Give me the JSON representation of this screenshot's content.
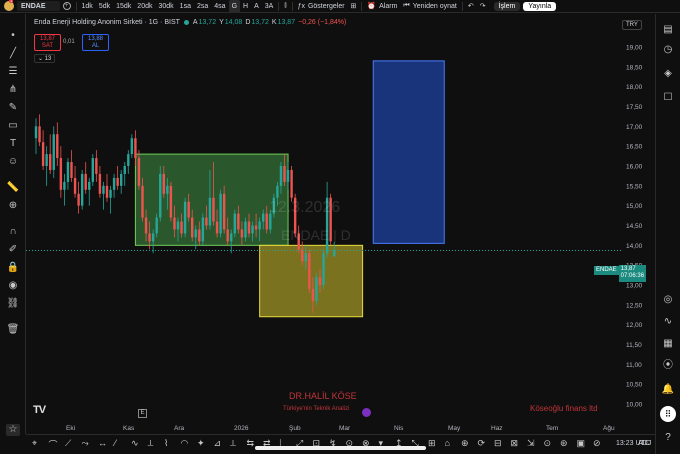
{
  "topbar": {
    "notification_count": "1",
    "symbol": "ENDAE",
    "intervals": [
      "1dk",
      "5dk",
      "15dk",
      "20dk",
      "30dk",
      "1sa",
      "2sa",
      "4sa",
      "G",
      "H",
      "A",
      "3A"
    ],
    "active_interval": "G",
    "indicators_label": "Göstergeler",
    "alarm_label": "Alarm",
    "replay_label": "Yeniden oynat",
    "trade_label": "İşlem",
    "publish_label": "Yayınla"
  },
  "legend": {
    "title": "Enda Enerji Holding Anonim Sirketi · 1G · BIST",
    "o_label": "A",
    "o_value": "13,72",
    "h_label": "Y",
    "h_value": "14,08",
    "l_label": "D",
    "l_value": "13,72",
    "c_label": "K",
    "c_value": "13,87",
    "change": "−0,26 (−1,84%)",
    "sell_price": "13,87",
    "sell_label": "SAT",
    "spread": "0,01",
    "buy_price": "13,88",
    "buy_label": "AL",
    "indicator_count": "13"
  },
  "currency": "TRY",
  "price_label": {
    "symbol": "ENDAE",
    "price": "13,87",
    "countdown": "07:06:36"
  },
  "watermark": {
    "date": "12.3.2026",
    "symbol_text": "ENDAE | D"
  },
  "branding": {
    "author": "DR.HALİL KÖSE",
    "subtitle": "Türkiye'nin Teknik Analizi",
    "firm": "Köseoğlu finans ltd"
  },
  "time_display": "13:23 UTC",
  "adj_label": "ADJ",
  "colors": {
    "up": "#26a69a",
    "down": "#ef5350",
    "green_zone": "#4caf50",
    "yellow_zone": "#d4c42c",
    "blue_zone": "#2962ff",
    "accent": "#2962ff"
  },
  "chart_data": {
    "type": "candlestick",
    "y_axis": [
      "19,00",
      "18,50",
      "18,00",
      "17,50",
      "17,00",
      "16,50",
      "16,00",
      "15,50",
      "15,00",
      "14,50",
      "14,00",
      "13,50",
      "13,00",
      "12,50",
      "12,00",
      "11,50",
      "11,00",
      "10,50",
      "10,00"
    ],
    "ylim": [
      10.0,
      19.0
    ],
    "x_axis": [
      "Eki",
      "Kas",
      "Ara",
      "2026",
      "Şub",
      "Mar",
      "Nis",
      "May",
      "Haz",
      "Tem",
      "Ağu"
    ],
    "candles": [
      {
        "o": 16.7,
        "h": 17.2,
        "l": 16.3,
        "c": 17.0
      },
      {
        "o": 17.0,
        "h": 17.3,
        "l": 16.5,
        "c": 16.6
      },
      {
        "o": 16.6,
        "h": 16.9,
        "l": 15.9,
        "c": 16.0
      },
      {
        "o": 16.0,
        "h": 16.5,
        "l": 15.5,
        "c": 16.3
      },
      {
        "o": 16.3,
        "h": 16.8,
        "l": 15.8,
        "c": 15.9
      },
      {
        "o": 15.9,
        "h": 17.0,
        "l": 15.7,
        "c": 16.8
      },
      {
        "o": 16.8,
        "h": 17.1,
        "l": 16.0,
        "c": 16.2
      },
      {
        "o": 16.2,
        "h": 16.5,
        "l": 15.2,
        "c": 15.4
      },
      {
        "o": 15.4,
        "h": 15.8,
        "l": 15.0,
        "c": 15.6
      },
      {
        "o": 15.6,
        "h": 16.2,
        "l": 15.4,
        "c": 16.1
      },
      {
        "o": 16.1,
        "h": 16.4,
        "l": 15.6,
        "c": 15.7
      },
      {
        "o": 15.7,
        "h": 16.0,
        "l": 15.2,
        "c": 15.3
      },
      {
        "o": 15.3,
        "h": 15.6,
        "l": 14.8,
        "c": 15.0
      },
      {
        "o": 15.0,
        "h": 15.9,
        "l": 14.9,
        "c": 15.8
      },
      {
        "o": 15.8,
        "h": 16.1,
        "l": 15.3,
        "c": 15.4
      },
      {
        "o": 15.4,
        "h": 15.7,
        "l": 15.0,
        "c": 15.6
      },
      {
        "o": 15.6,
        "h": 16.3,
        "l": 15.5,
        "c": 16.2
      },
      {
        "o": 16.2,
        "h": 16.4,
        "l": 15.6,
        "c": 15.8
      },
      {
        "o": 15.8,
        "h": 16.0,
        "l": 15.2,
        "c": 15.3
      },
      {
        "o": 15.3,
        "h": 15.6,
        "l": 14.9,
        "c": 15.5
      },
      {
        "o": 15.5,
        "h": 15.8,
        "l": 15.1,
        "c": 15.2
      },
      {
        "o": 15.2,
        "h": 15.5,
        "l": 14.8,
        "c": 15.4
      },
      {
        "o": 15.4,
        "h": 15.8,
        "l": 15.2,
        "c": 15.7
      },
      {
        "o": 15.7,
        "h": 16.0,
        "l": 15.4,
        "c": 15.5
      },
      {
        "o": 15.5,
        "h": 15.9,
        "l": 15.3,
        "c": 15.8
      },
      {
        "o": 15.8,
        "h": 16.1,
        "l": 15.5,
        "c": 16.0
      },
      {
        "o": 16.0,
        "h": 16.4,
        "l": 15.8,
        "c": 16.3
      },
      {
        "o": 16.3,
        "h": 16.8,
        "l": 16.2,
        "c": 16.7
      },
      {
        "o": 16.7,
        "h": 16.9,
        "l": 16.0,
        "c": 16.2
      },
      {
        "o": 16.2,
        "h": 16.4,
        "l": 15.4,
        "c": 15.5
      },
      {
        "o": 15.5,
        "h": 15.7,
        "l": 14.6,
        "c": 14.7
      },
      {
        "o": 14.7,
        "h": 14.9,
        "l": 14.1,
        "c": 14.3
      },
      {
        "o": 14.3,
        "h": 14.6,
        "l": 13.9,
        "c": 14.1
      },
      {
        "o": 14.1,
        "h": 14.4,
        "l": 13.8,
        "c": 14.3
      },
      {
        "o": 14.3,
        "h": 14.8,
        "l": 14.2,
        "c": 14.7
      },
      {
        "o": 14.7,
        "h": 16.0,
        "l": 14.6,
        "c": 15.8
      },
      {
        "o": 15.8,
        "h": 16.0,
        "l": 15.2,
        "c": 15.3
      },
      {
        "o": 15.3,
        "h": 15.7,
        "l": 14.9,
        "c": 15.5
      },
      {
        "o": 15.5,
        "h": 15.6,
        "l": 14.6,
        "c": 14.7
      },
      {
        "o": 14.7,
        "h": 15.0,
        "l": 14.2,
        "c": 14.4
      },
      {
        "o": 14.4,
        "h": 14.7,
        "l": 14.1,
        "c": 14.6
      },
      {
        "o": 14.6,
        "h": 14.8,
        "l": 14.2,
        "c": 14.3
      },
      {
        "o": 14.3,
        "h": 15.2,
        "l": 14.2,
        "c": 15.1
      },
      {
        "o": 15.1,
        "h": 15.3,
        "l": 14.6,
        "c": 14.7
      },
      {
        "o": 14.7,
        "h": 14.9,
        "l": 14.1,
        "c": 14.2
      },
      {
        "o": 14.2,
        "h": 14.5,
        "l": 13.9,
        "c": 14.4
      },
      {
        "o": 14.4,
        "h": 14.6,
        "l": 14.0,
        "c": 14.1
      },
      {
        "o": 14.1,
        "h": 14.8,
        "l": 14.0,
        "c": 14.7
      },
      {
        "o": 14.7,
        "h": 15.0,
        "l": 14.4,
        "c": 14.5
      },
      {
        "o": 14.5,
        "h": 15.9,
        "l": 14.4,
        "c": 15.2
      },
      {
        "o": 15.2,
        "h": 16.1,
        "l": 14.5,
        "c": 14.6
      },
      {
        "o": 14.6,
        "h": 14.9,
        "l": 14.2,
        "c": 14.3
      },
      {
        "o": 14.3,
        "h": 15.4,
        "l": 14.2,
        "c": 15.3
      },
      {
        "o": 15.3,
        "h": 15.5,
        "l": 14.3,
        "c": 14.4
      },
      {
        "o": 14.4,
        "h": 14.7,
        "l": 14.0,
        "c": 14.1
      },
      {
        "o": 14.1,
        "h": 14.4,
        "l": 13.8,
        "c": 14.3
      },
      {
        "o": 14.3,
        "h": 14.9,
        "l": 14.2,
        "c": 14.8
      },
      {
        "o": 14.8,
        "h": 15.0,
        "l": 14.3,
        "c": 14.4
      },
      {
        "o": 14.4,
        "h": 14.6,
        "l": 14.0,
        "c": 14.2
      },
      {
        "o": 14.2,
        "h": 14.7,
        "l": 14.1,
        "c": 14.6
      },
      {
        "o": 14.6,
        "h": 14.8,
        "l": 14.2,
        "c": 14.3
      },
      {
        "o": 14.3,
        "h": 14.6,
        "l": 14.1,
        "c": 14.5
      },
      {
        "o": 14.5,
        "h": 14.8,
        "l": 14.2,
        "c": 14.4
      },
      {
        "o": 14.4,
        "h": 14.7,
        "l": 14.1,
        "c": 14.6
      },
      {
        "o": 14.6,
        "h": 14.9,
        "l": 14.4,
        "c": 14.8
      },
      {
        "o": 14.8,
        "h": 15.0,
        "l": 14.3,
        "c": 14.4
      },
      {
        "o": 14.4,
        "h": 14.9,
        "l": 14.3,
        "c": 14.8
      },
      {
        "o": 14.8,
        "h": 15.3,
        "l": 14.7,
        "c": 15.2
      },
      {
        "o": 15.2,
        "h": 15.6,
        "l": 15.0,
        "c": 15.5
      },
      {
        "o": 15.5,
        "h": 16.1,
        "l": 15.3,
        "c": 16.0
      },
      {
        "o": 16.0,
        "h": 16.3,
        "l": 15.5,
        "c": 15.6
      },
      {
        "o": 15.6,
        "h": 16.1,
        "l": 15.4,
        "c": 15.9
      },
      {
        "o": 15.9,
        "h": 16.0,
        "l": 15.1,
        "c": 15.2
      },
      {
        "o": 15.2,
        "h": 15.3,
        "l": 14.2,
        "c": 14.3
      },
      {
        "o": 14.3,
        "h": 14.5,
        "l": 13.8,
        "c": 13.9
      },
      {
        "o": 13.9,
        "h": 14.1,
        "l": 13.5,
        "c": 13.6
      },
      {
        "o": 13.6,
        "h": 14.0,
        "l": 13.4,
        "c": 13.8
      },
      {
        "o": 13.8,
        "h": 13.9,
        "l": 12.8,
        "c": 12.9
      },
      {
        "o": 12.9,
        "h": 13.2,
        "l": 12.3,
        "c": 12.6
      },
      {
        "o": 12.6,
        "h": 13.3,
        "l": 12.5,
        "c": 13.2
      },
      {
        "o": 13.2,
        "h": 13.4,
        "l": 12.8,
        "c": 13.0
      },
      {
        "o": 13.0,
        "h": 13.9,
        "l": 12.9,
        "c": 13.8
      },
      {
        "o": 13.8,
        "h": 15.6,
        "l": 13.7,
        "c": 15.2
      },
      {
        "o": 15.2,
        "h": 15.3,
        "l": 14.0,
        "c": 14.1
      },
      {
        "o": 13.72,
        "h": 14.08,
        "l": 13.72,
        "c": 13.87
      }
    ],
    "zones": [
      {
        "name": "green",
        "from_index": 28,
        "to_index": 71,
        "top": 16.3,
        "bottom": 14.0
      },
      {
        "name": "yellow",
        "from_index": 63,
        "to_index": 92,
        "top": 14.0,
        "bottom": 12.2
      },
      {
        "name": "blue",
        "from_index": 95,
        "to_index": 115,
        "top": 18.65,
        "bottom": 14.05
      }
    ],
    "last_price": 13.87
  }
}
